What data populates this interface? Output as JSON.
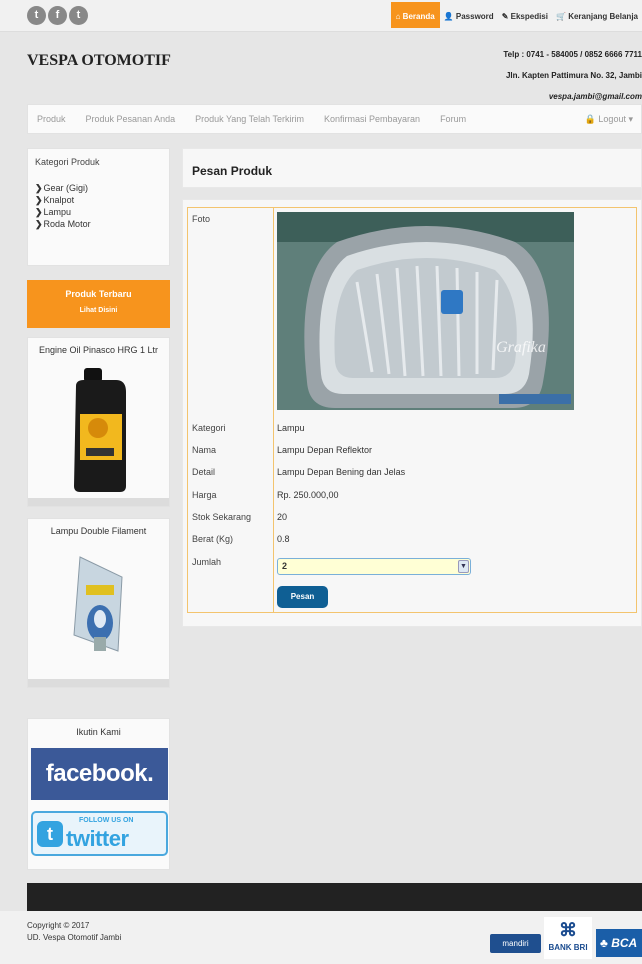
{
  "social": [
    {
      "name": "twitter-icon",
      "glyph": "🐦"
    },
    {
      "name": "facebook-icon",
      "glyph": "f"
    },
    {
      "name": "tumblr-icon",
      "glyph": "t"
    }
  ],
  "topnav": {
    "home": "Beranda",
    "password": "Password",
    "ekspedisi": "Ekspedisi",
    "cart": "Keranjang Belanja"
  },
  "brand": "VESPA OTOMOTIF",
  "contact": {
    "phone": "Telp : 0741 - 584005 / 0852 6666 7711",
    "address": "Jln. Kapten Pattimura No. 32, Jambi",
    "email": "vespa.jambi@gmail.com"
  },
  "mainnav": {
    "items": [
      "Produk",
      "Produk Pesanan Anda",
      "Produk Yang Telah Terkirim",
      "Konfirmasi Pembayaran",
      "Forum"
    ],
    "logout": "Logout"
  },
  "sidebar": {
    "category_title": "Kategori Produk",
    "categories": [
      "Gear (Gigi)",
      "Knalpot",
      "Lampu",
      "Roda Motor"
    ],
    "promo_title": "Produk Terbaru",
    "promo_link": "Lihat Disini",
    "products": [
      "Engine Oil Pinasco HRG 1 Ltr",
      "Lampu Double Filament"
    ],
    "follow_title": "Ikutin Kami",
    "facebook_label": "facebook.",
    "twitter_follow": "FOLLOW US ON",
    "twitter_label": "twitter"
  },
  "content": {
    "title": "Pesan Produk",
    "labels": {
      "foto": "Foto",
      "kategori": "Kategori",
      "nama": "Nama",
      "detail": "Detail",
      "harga": "Harga",
      "stok": "Stok Sekarang",
      "berat": "Berat (Kg)",
      "jumlah": "Jumlah"
    },
    "values": {
      "kategori": "Lampu",
      "nama": "Lampu Depan Reflektor",
      "detail": "Lampu Depan Bening dan Jelas",
      "harga": "Rp. 250.000,00",
      "stok": "20",
      "berat": "0.8",
      "jumlah": "2"
    },
    "watermark": "Grafika",
    "button": "Pesan"
  },
  "footer": {
    "copyright": "Copyright © 2017",
    "company": "UD. Vespa Otomotif Jambi",
    "banks": {
      "mandiri": "mandiri",
      "bri": "BANK BRI",
      "bca": "BCA"
    }
  }
}
